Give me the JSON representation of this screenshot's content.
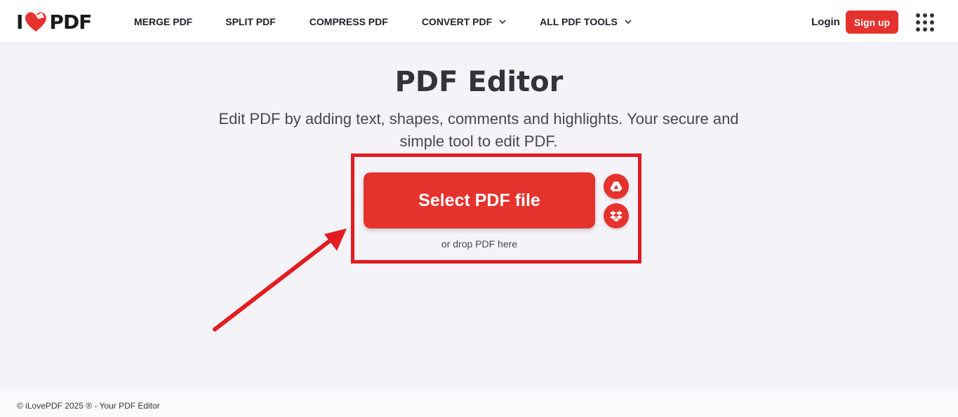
{
  "header": {
    "logo": {
      "left_text": "I",
      "right_text": "PDF",
      "icon": "heart-icon"
    },
    "nav": [
      {
        "label": "MERGE PDF",
        "has_dropdown": false
      },
      {
        "label": "SPLIT PDF",
        "has_dropdown": false
      },
      {
        "label": "COMPRESS PDF",
        "has_dropdown": false
      },
      {
        "label": "CONVERT PDF",
        "has_dropdown": true
      },
      {
        "label": "ALL PDF TOOLS",
        "has_dropdown": true
      }
    ],
    "login_label": "Login",
    "signup_label": "Sign up",
    "apps_icon": "grid-menu-icon"
  },
  "main": {
    "title": "PDF Editor",
    "subtitle": "Edit PDF by adding text, shapes, comments and highlights. Your secure and simple tool to edit PDF.",
    "select_label": "Select PDF file",
    "drop_hint": "or drop PDF here",
    "cloud_buttons": [
      {
        "icon": "google-drive-icon"
      },
      {
        "icon": "dropbox-icon"
      }
    ]
  },
  "annotation": {
    "color": "#e21d22",
    "shape": "arrow-and-box"
  },
  "footer": {
    "text": "© iLovePDF 2025 ® - Your PDF Editor"
  },
  "colors": {
    "brand": "#e5322d",
    "background": "#f4f3f8",
    "text": "#33333b"
  }
}
